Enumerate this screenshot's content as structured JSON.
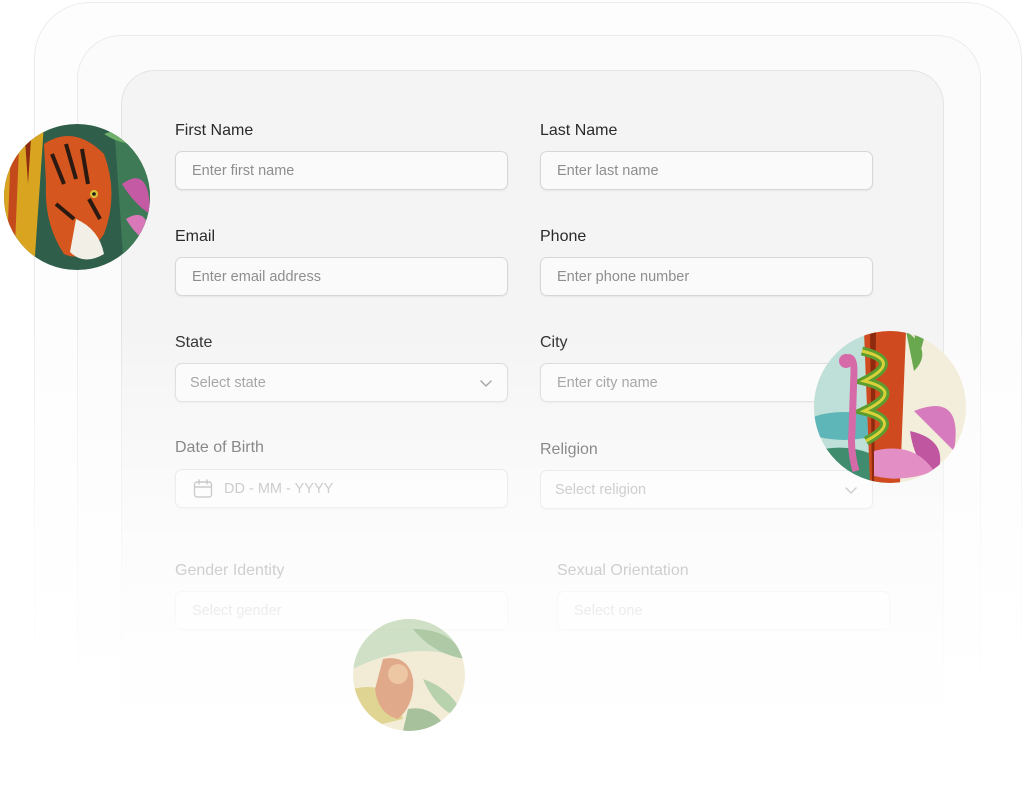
{
  "form": {
    "first_name": {
      "label": "First Name",
      "placeholder": "Enter first name"
    },
    "last_name": {
      "label": "Last Name",
      "placeholder": "Enter last name"
    },
    "email": {
      "label": "Email",
      "placeholder": "Enter email address"
    },
    "phone": {
      "label": "Phone",
      "placeholder": "Enter phone number"
    },
    "state": {
      "label": "State",
      "placeholder": "Select state"
    },
    "city": {
      "label": "City",
      "placeholder": "Enter city name"
    },
    "dob": {
      "label": "Date of Birth",
      "placeholder": "DD - MM - YYYY"
    },
    "religion": {
      "label": "Religion",
      "placeholder": "Select religion"
    },
    "gender_identity": {
      "label": "Gender Identity",
      "placeholder": "Select gender"
    },
    "sexual_orientation": {
      "label": "Sexual Orientation",
      "placeholder": "Select one"
    }
  },
  "icons": {
    "dropdown": "chevron-down-icon",
    "date": "calendar-icon"
  },
  "colors": {
    "card_background": "#f4f4f4",
    "input_border": "#d7d7d7",
    "label_text": "#2a2a2a",
    "placeholder_text": "#8e8e8e"
  }
}
